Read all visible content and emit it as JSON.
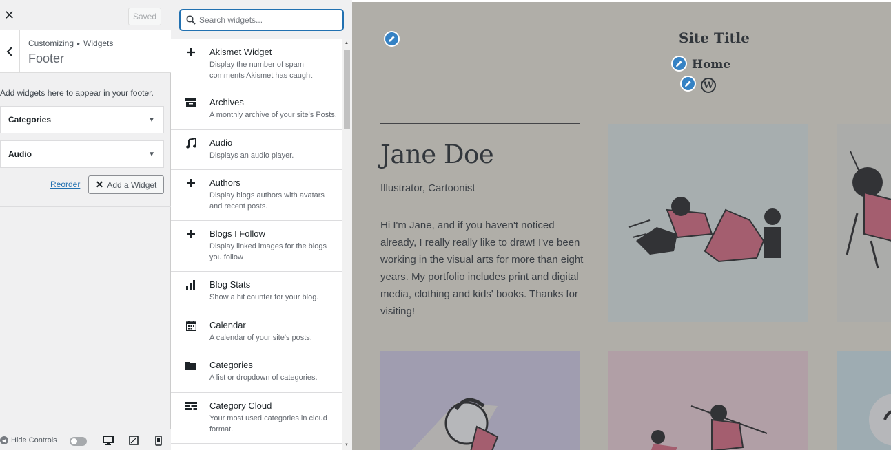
{
  "customizer": {
    "close_label": "✕",
    "saved_label": "Saved",
    "breadcrumb": [
      "Customizing",
      "Widgets"
    ],
    "breadcrumb_sep": "▸",
    "section_title": "Footer",
    "description": "Add widgets here to appear in your footer.",
    "widgets": [
      {
        "label": "Categories"
      },
      {
        "label": "Audio"
      }
    ],
    "reorder_label": "Reorder",
    "add_widget_label": "Add a Widget",
    "hide_controls_label": "Hide Controls"
  },
  "widget_search": {
    "placeholder": "Search widgets..."
  },
  "available_widgets": [
    {
      "title": "Akismet Widget",
      "desc": "Display the number of spam comments Akismet has caught",
      "icon": "plus-icon"
    },
    {
      "title": "Archives",
      "desc": "A monthly archive of your site's Posts.",
      "icon": "archive-icon"
    },
    {
      "title": "Audio",
      "desc": "Displays an audio player.",
      "icon": "music-note-icon"
    },
    {
      "title": "Authors",
      "desc": "Display blogs authors with avatars and recent posts.",
      "icon": "plus-icon"
    },
    {
      "title": "Blogs I Follow",
      "desc": "Display linked images for the blogs you follow",
      "icon": "plus-icon"
    },
    {
      "title": "Blog Stats",
      "desc": "Show a hit counter for your blog.",
      "icon": "bar-chart-icon"
    },
    {
      "title": "Calendar",
      "desc": "A calendar of your site's posts.",
      "icon": "calendar-icon"
    },
    {
      "title": "Categories",
      "desc": "A list or dropdown of categories.",
      "icon": "folder-icon"
    },
    {
      "title": "Category Cloud",
      "desc": "Your most used categories in cloud format.",
      "icon": "cloud-list-icon"
    }
  ],
  "preview": {
    "site_title": "Site Title",
    "nav_home": "Home",
    "wp_logo_letter": "W",
    "author_name": "Jane Doe",
    "author_role": "Illustrator, Cartoonist",
    "author_bio": "Hi I'm Jane, and if you haven't noticed already, I really really like to draw! I've been working in the visual arts for more than eight years. My portfolio includes print and digital media, clothing and kids' books. Thanks for visiting!"
  },
  "colors": {
    "accent": "#2271b1",
    "pencil": "#3582c4",
    "illustration_pink": "#e0667e"
  }
}
